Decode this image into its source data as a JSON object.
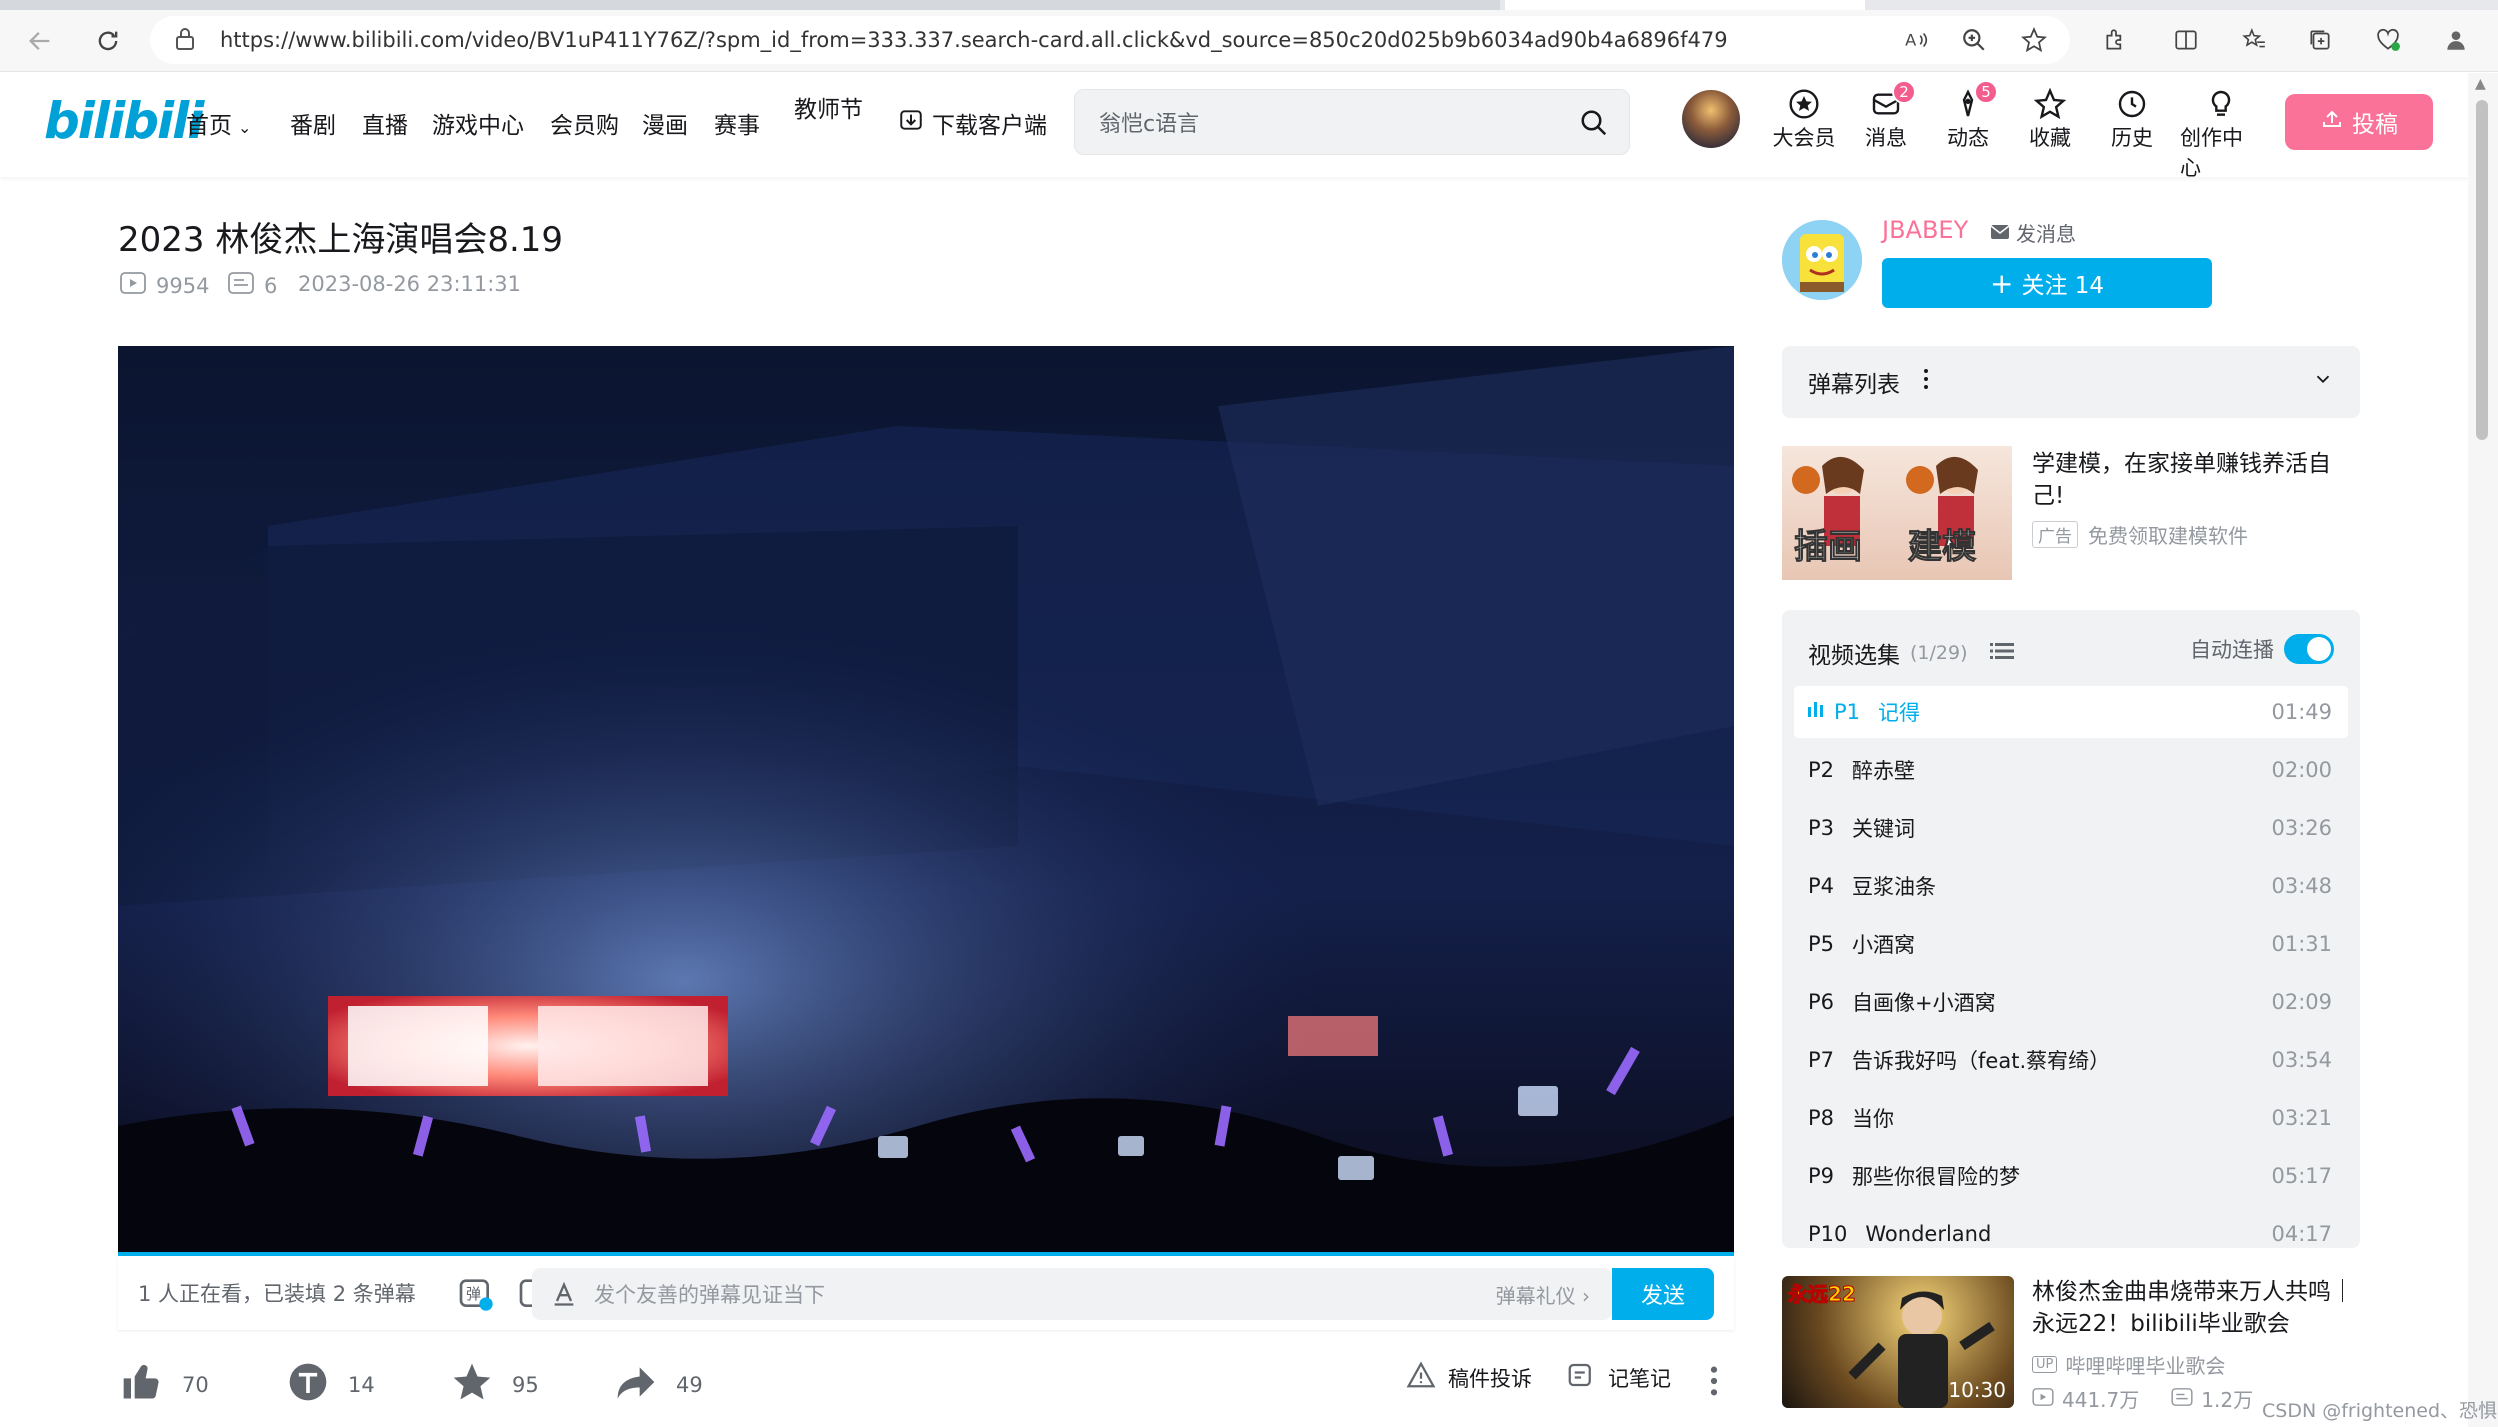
{
  "browser": {
    "url": "https://www.bilibili.com/video/BV1uP411Y76Z/?spm_id_from=333.337.search-card.all.click&vd_source=850c20d025b9b6034ad90b4a6896f479"
  },
  "header": {
    "logo": "bilibili",
    "nav": [
      "首页",
      "番剧",
      "直播",
      "游戏中心",
      "会员购",
      "漫画",
      "赛事",
      "教师节",
      "下载客户端"
    ],
    "search_placeholder": "翁恺c语言",
    "icons": [
      {
        "label": "大会员",
        "icon": "vip-icon",
        "badge": ""
      },
      {
        "label": "消息",
        "icon": "message-icon",
        "badge": "2"
      },
      {
        "label": "动态",
        "icon": "dynamic-icon",
        "badge": "5"
      },
      {
        "label": "收藏",
        "icon": "star-icon",
        "badge": ""
      },
      {
        "label": "历史",
        "icon": "clock-icon",
        "badge": ""
      },
      {
        "label": "创作中心",
        "icon": "bulb-icon",
        "badge": ""
      }
    ],
    "upload_label": "投稿"
  },
  "video": {
    "title": "2023 林俊杰上海演唱会8.19",
    "views": "9954",
    "danmaku_count": "6",
    "date": "2023-08-26 23:11:31"
  },
  "danmaku_bar": {
    "viewers_text": "1 人正在看，已装填 2 条弹幕",
    "input_placeholder": "发个友善的弹幕见证当下",
    "etiquette": "弹幕礼仪",
    "send": "发送"
  },
  "actions": {
    "like": "70",
    "coin": "14",
    "favorite": "95",
    "share": "49",
    "report": "稿件投诉",
    "notes": "记笔记"
  },
  "uploader": {
    "name": "JBABEY",
    "message": "发消息",
    "follow": "关注 14"
  },
  "danmaku_list": {
    "title": "弹幕列表"
  },
  "ad": {
    "img1_text": "插画",
    "img2_text": "建模",
    "title": "学建模，在家接单赚钱养活自己!",
    "tag": "广告",
    "subtitle": "免费领取建模软件"
  },
  "playlist": {
    "title": "视频选集",
    "count": "(1/29)",
    "autoplay": "自动连播",
    "episodes": [
      {
        "p": "P1",
        "name": "记得",
        "dur": "01:49"
      },
      {
        "p": "P2",
        "name": "醉赤壁",
        "dur": "02:00"
      },
      {
        "p": "P3",
        "name": "关键词",
        "dur": "03:26"
      },
      {
        "p": "P4",
        "name": "豆浆油条",
        "dur": "03:48"
      },
      {
        "p": "P5",
        "name": "小酒窝",
        "dur": "01:31"
      },
      {
        "p": "P6",
        "name": "自画像+小酒窝",
        "dur": "02:09"
      },
      {
        "p": "P7",
        "name": "告诉我好吗（feat.蔡宥绮）",
        "dur": "03:54"
      },
      {
        "p": "P8",
        "name": "当你",
        "dur": "03:21"
      },
      {
        "p": "P9",
        "name": "那些你很冒险的梦",
        "dur": "05:17"
      },
      {
        "p": "P10",
        "name": "Wonderland",
        "dur": "04:17"
      }
    ]
  },
  "recommend": {
    "title": "林俊杰金曲串烧带来万人共鸣｜永远22！bilibili毕业歌会",
    "thumb_badge": "永远22",
    "duration": "10:30",
    "uploader_tag": "UP",
    "uploader": "哔哩哔哩毕业歌会",
    "views": "441.7万",
    "danmaku": "1.2万"
  },
  "watermark": "CSDN @frightened、恐惧",
  "colors": {
    "brand_blue": "#00aeec",
    "brand_pink": "#fb7299"
  }
}
